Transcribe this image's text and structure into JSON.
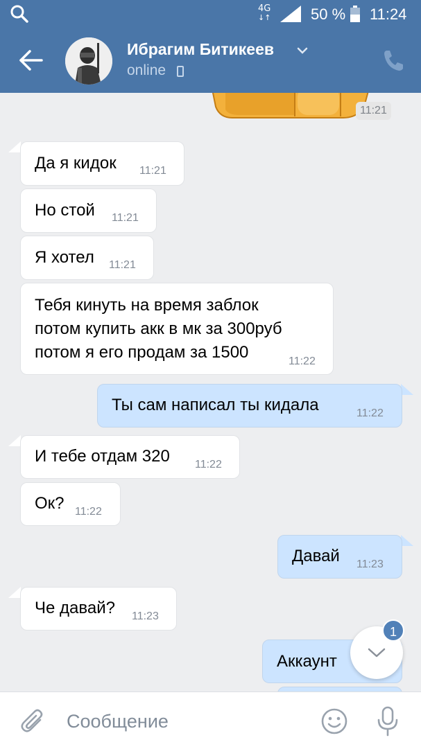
{
  "status_bar": {
    "network": "4G",
    "battery": "50 %",
    "time": "11:24"
  },
  "header": {
    "name": "Ибрагим Битикеев",
    "status": "online"
  },
  "sticker_time": "11:21",
  "messages": [
    {
      "dir": "in",
      "text": "Да я кидок",
      "time": "11:21"
    },
    {
      "dir": "in",
      "text": "Но стой",
      "time": "11:21"
    },
    {
      "dir": "in",
      "text": "Я хотел",
      "time": "11:21"
    },
    {
      "dir": "in",
      "lines": [
        "Тебя кинуть на время заблок",
        "потом купить акк в мк за 300руб",
        "потом я его продам за 1500"
      ],
      "time": "11:22"
    },
    {
      "dir": "out",
      "text": "Ты сам написал ты кидала",
      "time": "11:22"
    },
    {
      "dir": "in",
      "text": "И тебе отдам 320",
      "time": "11:22"
    },
    {
      "dir": "in",
      "text": "Ок?",
      "time": "11:22"
    },
    {
      "dir": "out",
      "text": "Давай",
      "time": "11:23"
    },
    {
      "dir": "in",
      "text": "Че давай?",
      "time": "11:23"
    },
    {
      "dir": "out",
      "text": "Аккаунт",
      "time": ""
    }
  ],
  "unread_badge": "1",
  "composer": {
    "placeholder": "Сообщение"
  },
  "colors": {
    "header": "#4a76a8",
    "incoming_bubble": "#ffffff",
    "outgoing_bubble": "#cce4ff",
    "background": "#edeef0"
  },
  "icons": [
    "search-icon",
    "signal-icon",
    "battery-icon",
    "back-arrow-icon",
    "chevron-down-icon",
    "phone-icon",
    "attach-icon",
    "emoji-icon",
    "microphone-icon"
  ]
}
